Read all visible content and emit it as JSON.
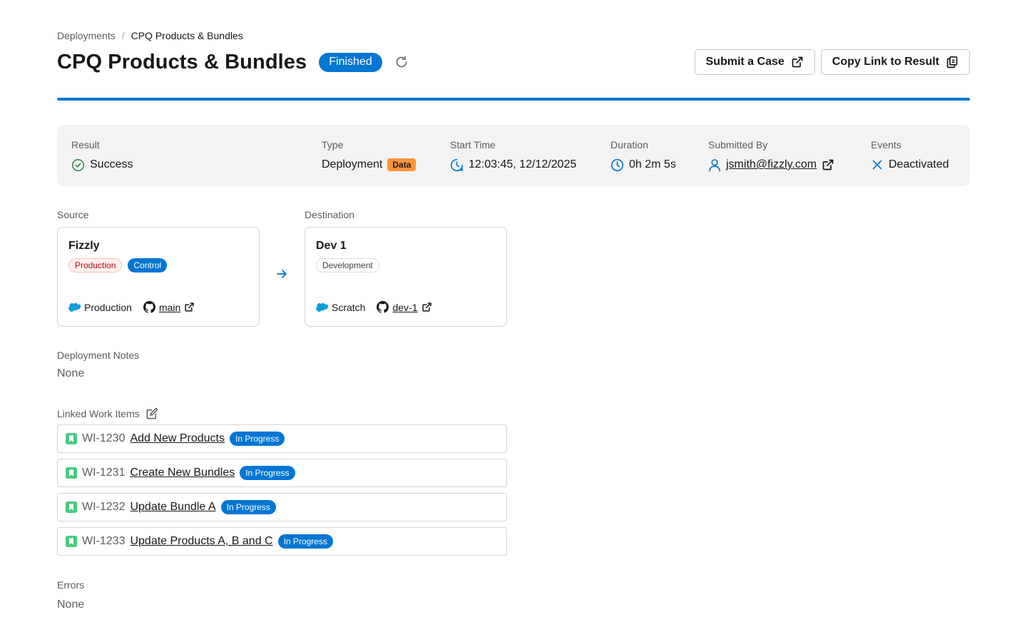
{
  "breadcrumb": {
    "parent": "Deployments",
    "separator": "/",
    "current": "CPQ Products & Bundles"
  },
  "header": {
    "title": "CPQ Products & Bundles",
    "status": "Finished",
    "submit_case_label": "Submit a Case",
    "copy_link_label": "Copy Link to Result"
  },
  "summary": {
    "result": {
      "label": "Result",
      "value": "Success"
    },
    "type": {
      "label": "Type",
      "value": "Deployment",
      "tag": "Data"
    },
    "start_time": {
      "label": "Start Time",
      "value": "12:03:45, 12/12/2025"
    },
    "duration": {
      "label": "Duration",
      "value": "0h 2m 5s"
    },
    "submitted_by": {
      "label": "Submitted By",
      "value": "jsmith@fizzly.com"
    },
    "events": {
      "label": "Events",
      "value": "Deactivated"
    }
  },
  "source": {
    "section_label": "Source",
    "name": "Fizzly",
    "tags": [
      "Production",
      "Control"
    ],
    "org_type": "Production",
    "branch": "main"
  },
  "destination": {
    "section_label": "Destination",
    "name": "Dev 1",
    "tags": [
      "Development"
    ],
    "org_type": "Scratch",
    "branch": "dev-1"
  },
  "deployment_notes": {
    "label": "Deployment Notes",
    "value": "None"
  },
  "linked_work_items": {
    "label": "Linked Work Items",
    "items": [
      {
        "key": "WI-1230",
        "title": "Add New Products",
        "status": "In Progress"
      },
      {
        "key": "WI-1231",
        "title": "Create New Bundles",
        "status": "In Progress"
      },
      {
        "key": "WI-1232",
        "title": "Update Bundle A",
        "status": "In Progress"
      },
      {
        "key": "WI-1233",
        "title": "Update Products A, B and C",
        "status": "In Progress"
      }
    ]
  },
  "errors": {
    "label": "Errors",
    "value": "None"
  },
  "colors": {
    "brand_blue": "#0176d3",
    "success_green": "#2e844a",
    "data_tag_orange": "#fe9339",
    "work_item_green": "#4bca81"
  }
}
